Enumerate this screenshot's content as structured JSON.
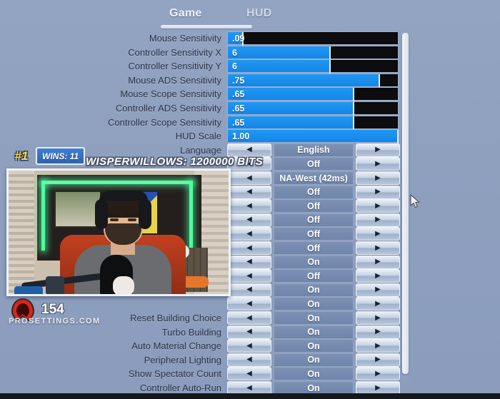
{
  "tabs": [
    {
      "label": "Game",
      "active": true
    },
    {
      "label": "HUD",
      "active": false
    }
  ],
  "colors": {
    "background": "#8fa1c0",
    "slider_fill": "#1387e8",
    "slider_track": "#0d0d0f",
    "value_bar": "#7c91b3",
    "accent_blue": "#2f63ad"
  },
  "settings": [
    {
      "label": "Mouse Sensitivity",
      "type": "slider",
      "value": ".09",
      "percent": 9
    },
    {
      "label": "Controller Sensitivity X",
      "type": "slider",
      "value": "6",
      "percent": 60
    },
    {
      "label": "Controller Sensitivity Y",
      "type": "slider",
      "value": "6",
      "percent": 60
    },
    {
      "label": "Mouse ADS Sensitivity",
      "type": "slider",
      "value": ".75",
      "percent": 89
    },
    {
      "label": "Mouse Scope Sensitivity",
      "type": "slider",
      "value": ".65",
      "percent": 74
    },
    {
      "label": "Controller ADS Sensitivity",
      "type": "slider",
      "value": ".65",
      "percent": 74
    },
    {
      "label": "Controller Scope Sensitivity",
      "type": "slider",
      "value": ".65",
      "percent": 74
    },
    {
      "label": "HUD Scale",
      "type": "slider",
      "value": "1.00",
      "percent": 100
    },
    {
      "label": "Language",
      "type": "stepper",
      "value": "English"
    },
    {
      "label": "",
      "type": "stepper",
      "value": "Off"
    },
    {
      "label": "",
      "type": "stepper",
      "value": "NA-West (42ms)"
    },
    {
      "label": "",
      "type": "stepper",
      "value": "Off"
    },
    {
      "label": "",
      "type": "stepper",
      "value": "Off"
    },
    {
      "label": "",
      "type": "stepper",
      "value": "Off"
    },
    {
      "label": "",
      "type": "stepper",
      "value": "Off"
    },
    {
      "label": "",
      "type": "stepper",
      "value": "Off"
    },
    {
      "label": "",
      "type": "stepper",
      "value": "On"
    },
    {
      "label": "",
      "type": "stepper",
      "value": "Off"
    },
    {
      "label": "",
      "type": "stepper",
      "value": "On"
    },
    {
      "label": "",
      "type": "stepper",
      "value": "On"
    },
    {
      "label": "Reset Building Choice",
      "type": "stepper",
      "value": "On"
    },
    {
      "label": "Turbo Building",
      "type": "stepper",
      "value": "On"
    },
    {
      "label": "Auto Material Change",
      "type": "stepper",
      "value": "On"
    },
    {
      "label": "Peripheral Lighting",
      "type": "stepper",
      "value": "On"
    },
    {
      "label": "Show Spectator Count",
      "type": "stepper",
      "value": "On"
    },
    {
      "label": "Controller Auto-Run",
      "type": "stepper",
      "value": "On"
    }
  ],
  "stepper_icons": {
    "left": "◀",
    "right": "▶"
  },
  "overlay": {
    "badge_rank": "#1",
    "badge_wins": "WINS: 11",
    "alert_text": "WISPERWILLOWS: 1200000 BITS",
    "follower_count": "154",
    "watermark": "PROSETTINGS.COM"
  }
}
